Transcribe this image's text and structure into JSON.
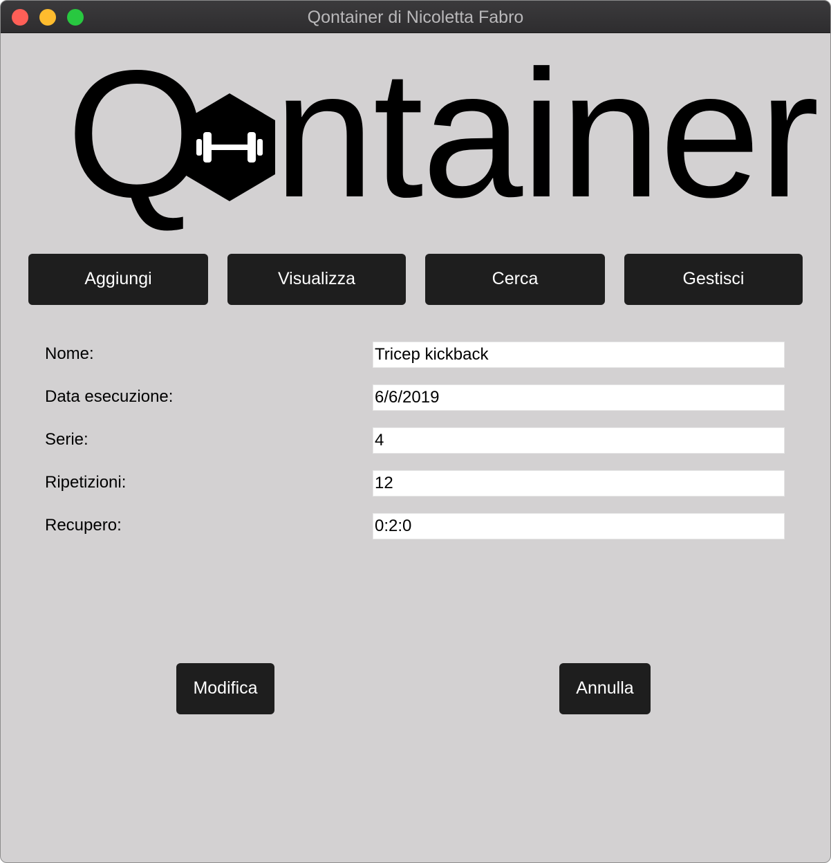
{
  "window": {
    "title": "Qontainer di Nicoletta Fabro"
  },
  "logo": {
    "text": "Qontainer"
  },
  "nav": {
    "items": [
      {
        "label": "Aggiungi"
      },
      {
        "label": "Visualizza"
      },
      {
        "label": "Cerca"
      },
      {
        "label": "Gestisci"
      }
    ]
  },
  "form": {
    "fields": [
      {
        "label": "Nome:",
        "value": "Tricep kickback"
      },
      {
        "label": "Data esecuzione:",
        "value": "6/6/2019"
      },
      {
        "label": "Serie:",
        "value": "4"
      },
      {
        "label": "Ripetizioni:",
        "value": "12"
      },
      {
        "label": "Recupero:",
        "value": "0:2:0"
      }
    ]
  },
  "actions": {
    "modify_label": "Modifica",
    "cancel_label": "Annulla"
  },
  "icons": {
    "logo_badge": "dumbbell-hexagon-icon"
  }
}
